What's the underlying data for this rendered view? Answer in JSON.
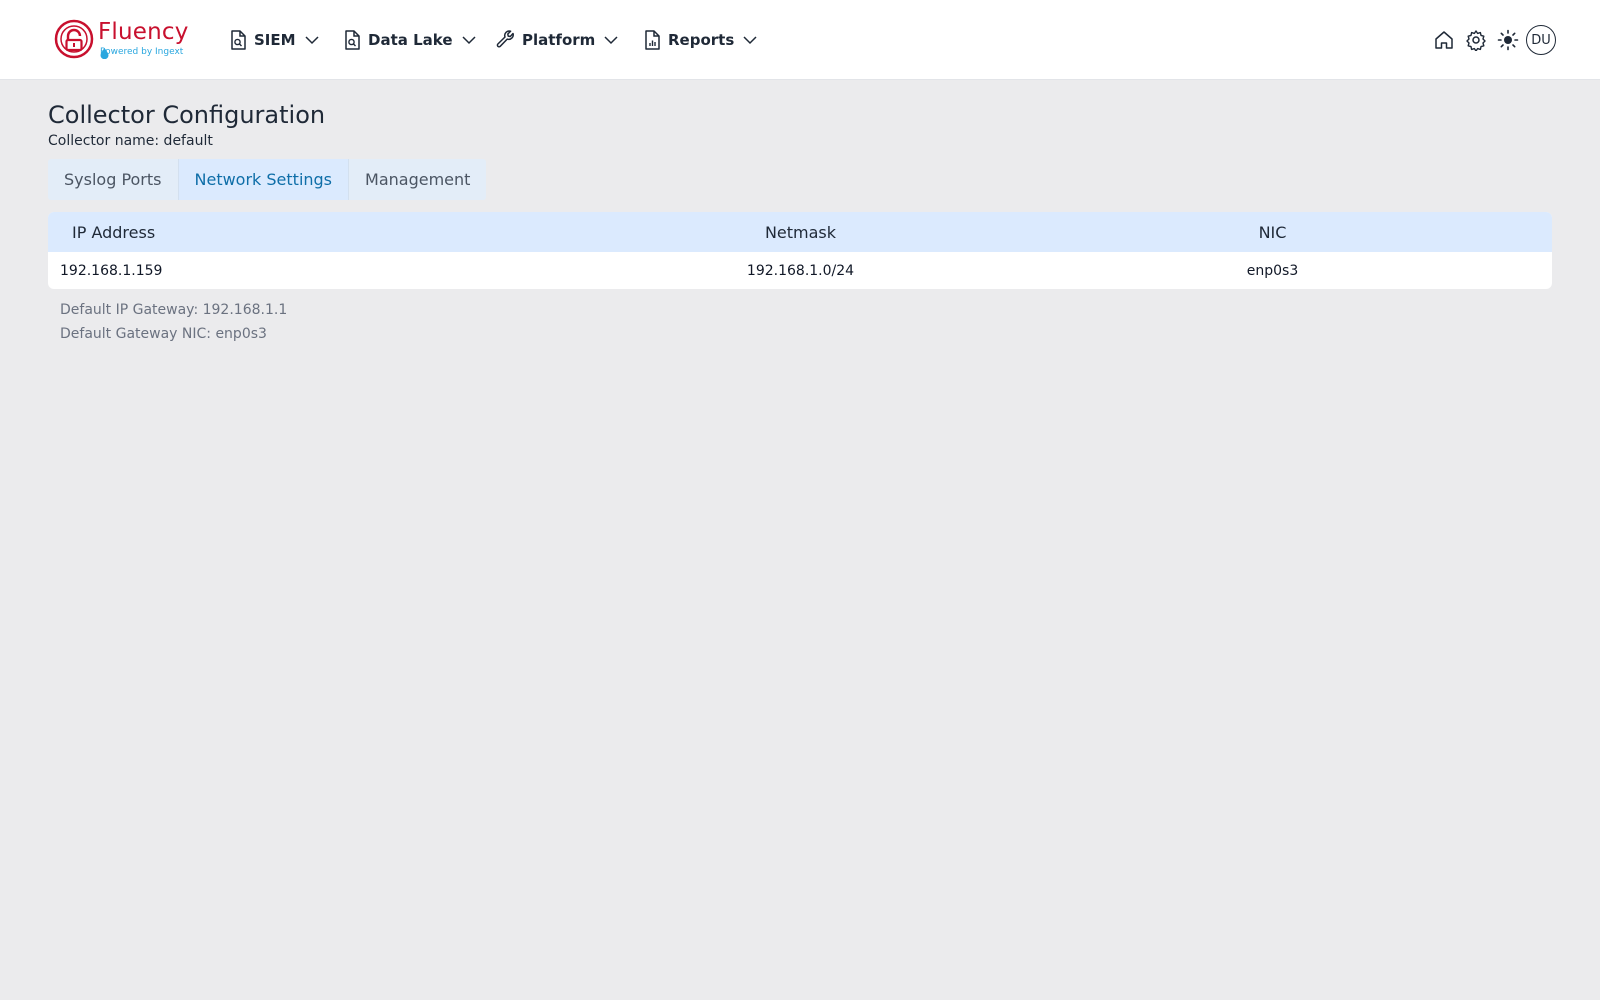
{
  "logo": {
    "name": "Fluency",
    "sub": "Powered by Ingext"
  },
  "nav": [
    {
      "label": "SIEM",
      "icon": "document-search-icon"
    },
    {
      "label": "Data Lake",
      "icon": "document-search-icon"
    },
    {
      "label": "Platform",
      "icon": "wrench-icon"
    },
    {
      "label": "Reports",
      "icon": "document-chart-icon"
    }
  ],
  "header_icons": [
    "home-icon",
    "gear-icon",
    "sun-icon"
  ],
  "user": {
    "initials": "DU"
  },
  "page": {
    "title": "Collector Configuration",
    "collector_name": "Collector name: default"
  },
  "tabs": [
    {
      "label": "Syslog Ports",
      "active": false
    },
    {
      "label": "Network Settings",
      "active": true
    },
    {
      "label": "Management",
      "active": false
    }
  ],
  "table": {
    "headers": [
      "IP Address",
      "Netmask",
      "NIC"
    ],
    "rows": [
      [
        "192.168.1.159",
        "192.168.1.0/24",
        "enp0s3"
      ]
    ]
  },
  "footer": {
    "gateway": "Default IP Gateway: 192.168.1.1",
    "gateway_nic": "Default Gateway NIC: enp0s3"
  },
  "colors": {
    "brand": "#c8102e",
    "accent": "#0e6ea8",
    "header_bg": "#dbeafe",
    "page_bg": "#ebebed"
  }
}
